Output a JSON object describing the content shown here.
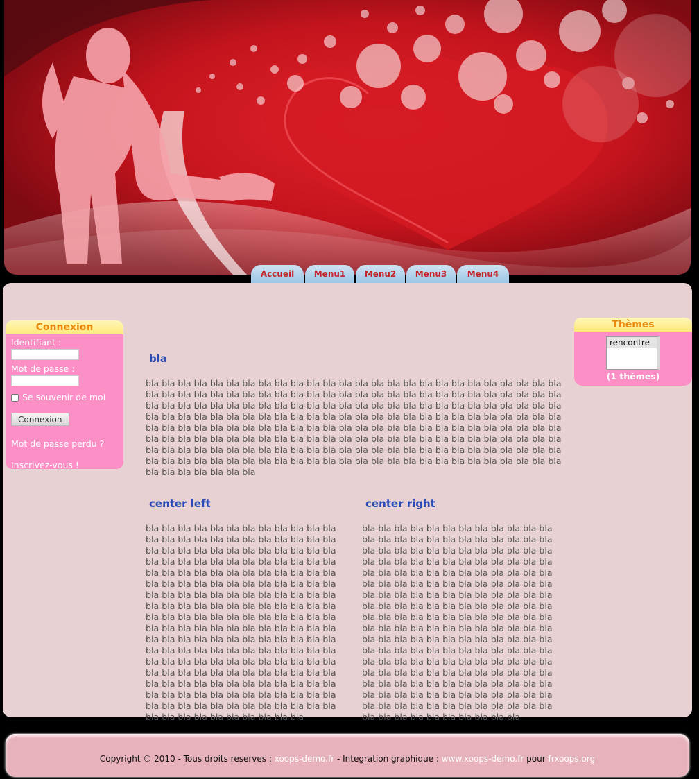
{
  "nav": {
    "tabs": [
      "Accueil",
      "Menu1",
      "Menu2",
      "Menu3",
      "Menu4"
    ]
  },
  "login": {
    "title": "Connexion",
    "username_label": "Identifiant :",
    "password_label": "Mot de passe :",
    "remember_label": "Se souvenir de moi",
    "submit_label": "Connexion",
    "lost_password": "Mot de passe perdu ?",
    "register": "Inscrivez-vous !"
  },
  "themes": {
    "title": "Thèmes",
    "selected": "rencontre",
    "count": "(1 thèmes)"
  },
  "content": {
    "main_title": "bla",
    "main_text": "bla bla bla bla bla bla bla bla bla bla bla bla bla bla bla bla bla bla bla bla bla bla bla bla bla bla bla bla bla bla bla bla bla bla bla bla bla bla bla bla bla bla bla bla bla bla bla bla bla bla bla bla bla bla bla bla bla bla bla bla bla bla bla bla bla bla bla bla bla bla bla bla bla bla bla bla bla bla bla bla bla bla bla bla bla bla bla bla bla bla bla bla bla bla bla bla bla bla bla bla bla bla bla bla bla bla bla bla bla bla bla bla bla bla bla bla bla bla bla bla bla bla bla bla bla bla bla bla bla bla bla bla bla bla bla bla bla bla bla bla bla bla bla bla bla bla bla bla bla bla bla bla bla bla bla bla bla bla bla bla bla bla bla bla bla bla bla bla bla bla bla bla bla bla bla bla bla bla bla bla bla bla bla bla bla bla bla bla bla bla bla bla bla bla bla bla bla bla bla bla bla bla bla bla bla bla bla bla bla bla bla bla bla bla bla",
    "center_left_title": "center left",
    "center_left_text": "bla bla bla bla bla bla bla bla bla bla bla bla bla bla bla bla bla bla bla bla bla bla bla bla bla bla bla bla bla bla bla bla bla bla bla bla bla bla bla bla bla bla bla bla bla bla bla bla bla bla bla bla bla bla bla bla bla bla bla bla bla bla bla bla bla bla bla bla bla bla bla bla bla bla bla bla bla bla bla bla bla bla bla bla bla bla bla bla bla bla bla bla bla bla bla bla bla bla bla bla bla bla bla bla bla bla bla bla bla bla bla bla bla bla bla bla bla bla bla bla bla bla bla bla bla bla bla bla bla bla bla bla bla bla bla bla bla bla bla bla bla bla bla bla bla bla bla bla bla bla bla bla bla bla bla bla bla bla bla bla bla bla bla bla bla bla bla bla bla bla bla bla bla bla bla bla bla bla bla bla bla bla bla bla bla bla bla bla bla bla bla bla bla bla bla bla bla bla bla bla bla bla bla bla bla bla bla bla bla bla bla bla bla bla",
    "center_right_title": "center right",
    "center_right_text": "bla bla bla bla bla bla bla bla bla bla bla bla bla bla bla bla bla bla bla bla bla bla bla bla bla bla bla bla bla bla bla bla bla bla bla bla bla bla bla bla bla bla bla bla bla bla bla bla bla bla bla bla bla bla bla bla bla bla bla bla bla bla bla bla bla bla bla bla bla bla bla bla bla bla bla bla bla bla bla bla bla bla bla bla bla bla bla bla bla bla bla bla bla bla bla bla bla bla bla bla bla bla bla bla bla bla bla bla bla bla bla bla bla bla bla bla bla bla bla bla bla bla bla bla bla bla bla bla bla bla bla bla bla bla bla bla bla bla bla bla bla bla bla bla bla bla bla bla bla bla bla bla bla bla bla bla bla bla bla bla bla bla bla bla bla bla bla bla bla bla bla bla bla bla bla bla bla bla bla bla bla bla bla bla bla bla bla bla bla bla bla bla bla bla bla bla bla bla bla bla bla bla bla bla bla bla bla bla bla bla bla bla bla bla"
  },
  "footer": {
    "copyright": "Copyright © 2010 - Tous droits reserves : ",
    "link1": "xoops-demo.fr",
    "middle": " - Integration graphique : ",
    "link2": "www.xoops-demo.fr",
    "pour": " pour ",
    "link3": "frxoops.org"
  }
}
